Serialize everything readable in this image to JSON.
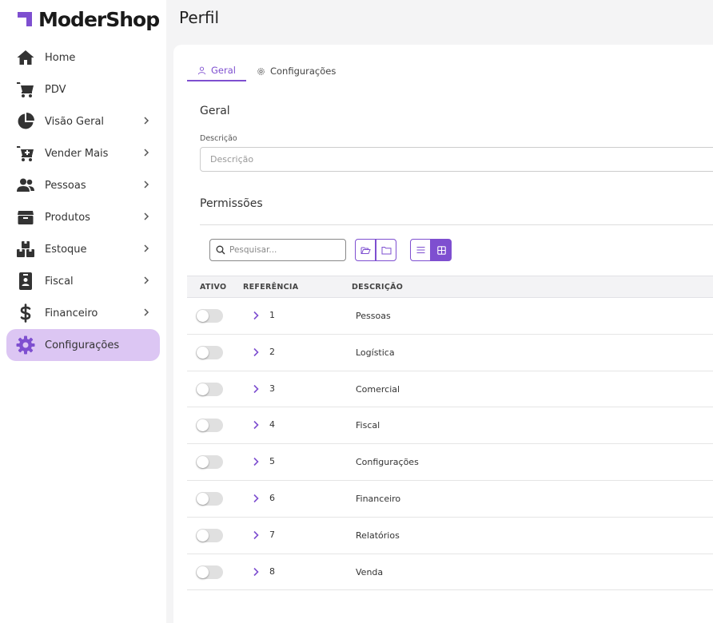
{
  "app": {
    "name": "ModerShop"
  },
  "page": {
    "title": "Perfil"
  },
  "colors": {
    "accent": "#7e4fd0",
    "active_nav_bg": "#dcc6f3",
    "icon": "#333333"
  },
  "sidebar": {
    "items": [
      {
        "label": "Home",
        "icon": "home-icon",
        "chevron": false,
        "active": false
      },
      {
        "label": "PDV",
        "icon": "cart-icon",
        "chevron": false,
        "active": false
      },
      {
        "label": "Visão Geral",
        "icon": "pie-chart-icon",
        "chevron": true,
        "active": false
      },
      {
        "label": "Vender Mais",
        "icon": "cart-plus-icon",
        "chevron": true,
        "active": false
      },
      {
        "label": "Pessoas",
        "icon": "people-icon",
        "chevron": true,
        "active": false
      },
      {
        "label": "Produtos",
        "icon": "box-icon",
        "chevron": true,
        "active": false
      },
      {
        "label": "Estoque",
        "icon": "boxes-icon",
        "chevron": true,
        "active": false
      },
      {
        "label": "Fiscal",
        "icon": "badge-icon",
        "chevron": true,
        "active": false
      },
      {
        "label": "Financeiro",
        "icon": "dollar-icon",
        "chevron": true,
        "active": false
      },
      {
        "label": "Configurações",
        "icon": "gear-icon",
        "chevron": false,
        "active": true
      }
    ]
  },
  "tabs": [
    {
      "label": "Geral",
      "icon": "user-icon",
      "active": true
    },
    {
      "label": "Configurações",
      "icon": "gear-icon",
      "active": false
    }
  ],
  "geral": {
    "section_title": "Geral",
    "description_label": "Descrição",
    "description_placeholder": "Descrição",
    "description_value": ""
  },
  "permissions": {
    "section_title": "Permissões",
    "search_placeholder": "Pesquisar...",
    "view_mode": "grid",
    "columns": {
      "ativo": "ATIVO",
      "referencia": "REFERÊNCIA",
      "descricao": "DESCRIÇÃO"
    },
    "rows": [
      {
        "active": false,
        "ref": "1",
        "desc": "Pessoas"
      },
      {
        "active": false,
        "ref": "2",
        "desc": "Logística"
      },
      {
        "active": false,
        "ref": "3",
        "desc": "Comercial"
      },
      {
        "active": false,
        "ref": "4",
        "desc": "Fiscal"
      },
      {
        "active": false,
        "ref": "5",
        "desc": "Configurações"
      },
      {
        "active": false,
        "ref": "6",
        "desc": "Financeiro"
      },
      {
        "active": false,
        "ref": "7",
        "desc": "Relatórios"
      },
      {
        "active": false,
        "ref": "8",
        "desc": "Venda"
      }
    ]
  }
}
